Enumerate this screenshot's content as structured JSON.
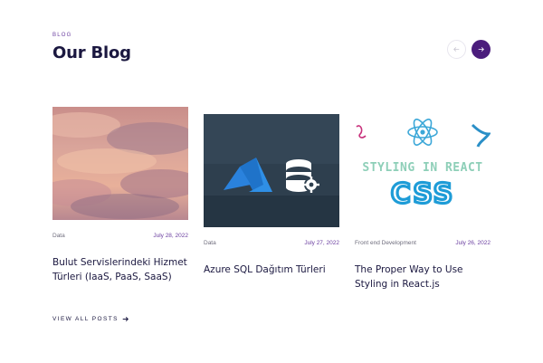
{
  "section": {
    "eyebrow": "BLOG",
    "title": "Our Blog"
  },
  "nav": {
    "prev_icon": "arrow-left-icon",
    "next_icon": "arrow-right-icon",
    "accent": "#4b1d7c"
  },
  "posts": [
    {
      "category": "Data",
      "date": "July 28, 2022",
      "title": "Bulut Servislerindeki Hizmet Türleri (IaaS, PaaS, SaaS)",
      "image": "sunset-clouds"
    },
    {
      "category": "Data",
      "date": "July 27, 2022",
      "title": "Azure SQL Dağıtım Türleri",
      "image": "azure-sql-logo"
    },
    {
      "category": "Front end Development",
      "date": "July 26, 2022",
      "title": "The Proper Way to Use Styling in React.js",
      "image": "styling-in-react-css",
      "image_text": [
        "STYLING IN REACT",
        "CSS"
      ]
    }
  ],
  "footer": {
    "view_all": "VIEW ALL POSTS"
  }
}
